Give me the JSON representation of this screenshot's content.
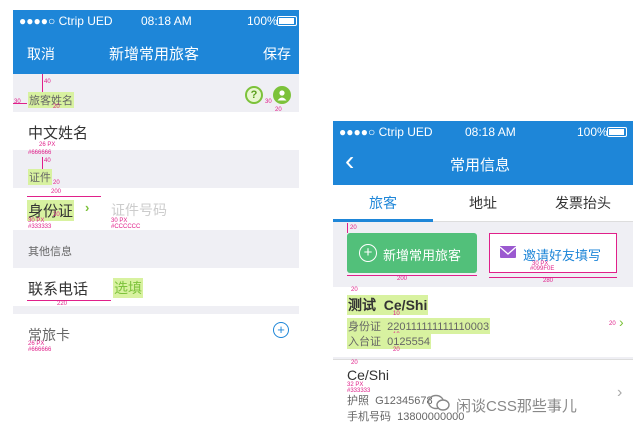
{
  "left_phone": {
    "status": {
      "carrier": "●●●●○ Ctrip UED",
      "time": "08:18 AM",
      "battery": "100%"
    },
    "nav": {
      "cancel": "取消",
      "title": "新增常用旅客",
      "save": "保存"
    },
    "section_traveler_name": "旅客姓名",
    "chinese_name_label": "中文姓名",
    "section_id": "证件",
    "id_type": "身份证",
    "id_placeholder": "证件号码",
    "section_other": "其他信息",
    "phone_label": "联系电话",
    "phone_value": "选填",
    "frequent_card": "常旅卡",
    "question_icon_label": "?",
    "annotations": {
      "a40_1": "40",
      "a30_1": "30",
      "a20_1": "20",
      "a30_r": "30",
      "a20_r": "20",
      "a26px_1": "26 PX",
      "a666_1": "#666666",
      "a40_2": "40",
      "a20_2": "20",
      "a200": "200",
      "a20_3": "20",
      "a30px": "30 PX",
      "a333": "#333333",
      "a30px_2": "30 PX",
      "accc": "#CCCCCC",
      "a220": "220",
      "a26px_2": "26 PX",
      "a666_2": "#666666"
    }
  },
  "right_phone": {
    "status": {
      "carrier": "●●●●○ Ctrip UED",
      "time": "08:18 AM",
      "battery": "100%"
    },
    "nav": {
      "back": "‹",
      "title": "常用信息"
    },
    "tabs": [
      "旅客",
      "地址",
      "发票抬头"
    ],
    "add_button": "新增常用旅客",
    "invite_button": "邀请好友填写",
    "entry1": {
      "name": "测试",
      "pinyin": "Ce/Shi",
      "id1_label": "身份证",
      "id1_value": "220111111111110003",
      "id2_label": "入台证",
      "id2_value": "0125554"
    },
    "entry2": {
      "name": "Ce/Shi",
      "passport_label": "护照",
      "passport_value": "G12345678",
      "phone_label": "手机号码",
      "phone_value": "13800000000"
    },
    "annotations": {
      "b20_1": "20",
      "b20_2": "20",
      "b30px": "30 PX",
      "b09f": "#099F0E",
      "b200": "200",
      "b280": "280",
      "b20_3": "20",
      "b20_4": "20",
      "b10_1": "10",
      "b10_2": "10",
      "b20_5": "20",
      "b20_6": "20",
      "b32px": "32 PX",
      "b333": "#333333",
      "b20_7": "20"
    }
  },
  "watermark": "闲谈CSS那些事儿",
  "colors": {
    "nav_blue": "#1e86d8",
    "highlight": "#d8f2a0",
    "annotation": "#e0208a",
    "green_button": "#52c07a",
    "invite_purple": "#9b59d0"
  }
}
